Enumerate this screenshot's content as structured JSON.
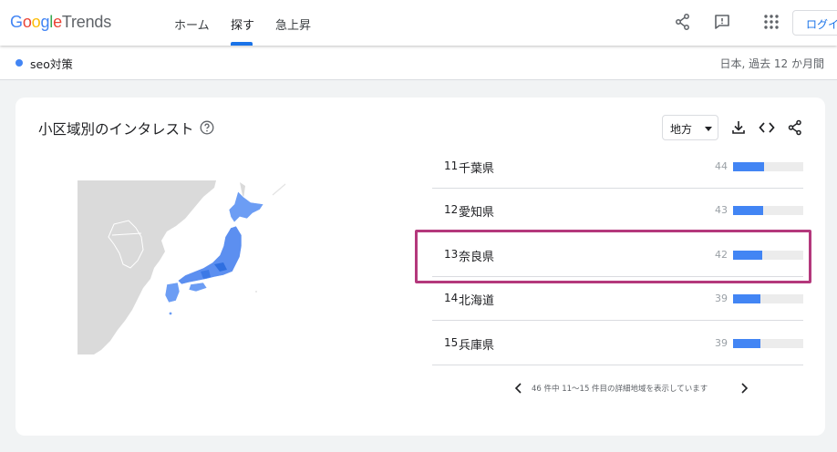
{
  "header": {
    "logo": {
      "google": "Google",
      "trends": "Trends"
    },
    "tabs": [
      {
        "label": "ホーム",
        "active": false
      },
      {
        "label": "探す",
        "active": true
      },
      {
        "label": "急上昇",
        "active": false
      }
    ],
    "login_label": "ログイ",
    "icons": [
      "share-icon",
      "feedback-icon",
      "apps-grid-icon"
    ]
  },
  "query": {
    "term": "seo対策",
    "term_color": "#4285f4",
    "scope": "日本, 過去 12 か月間"
  },
  "card": {
    "title": "小区域別のインタレスト",
    "resolution_select": "地方",
    "tools": [
      "download-icon",
      "embed-icon",
      "share-icon"
    ]
  },
  "regions": {
    "bar_color": "#4285f4",
    "rows": [
      {
        "rank": "11",
        "name": "千葉県",
        "value": 44
      },
      {
        "rank": "12",
        "name": "愛知県",
        "value": 43
      },
      {
        "rank": "13",
        "name": "奈良県",
        "value": 42,
        "highlighted": true
      },
      {
        "rank": "14",
        "name": "北海道",
        "value": 39
      },
      {
        "rank": "15",
        "name": "兵庫県",
        "value": 39
      }
    ],
    "pagination": "46 件中 11〜15 件目の詳細地域を表示しています"
  },
  "accent": {
    "blue": "#1a73e8",
    "highlight_border": "#b4387c"
  }
}
